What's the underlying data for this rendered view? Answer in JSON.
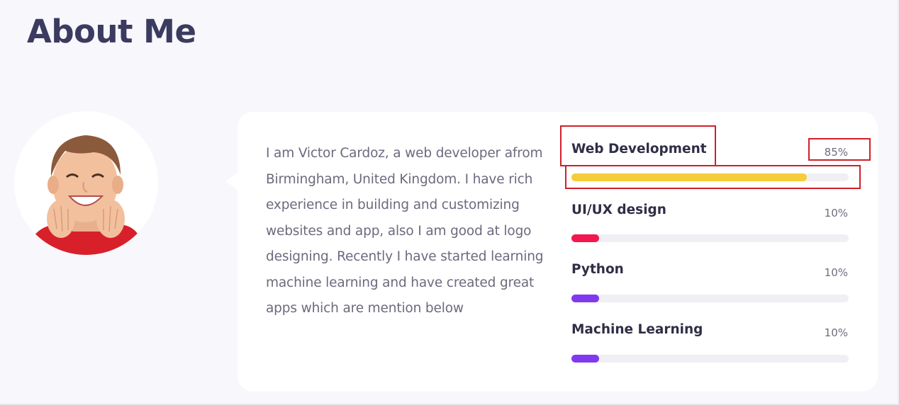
{
  "page": {
    "title": "About Me"
  },
  "profile": {
    "avatar_icon": "smiling-child-avatar",
    "bio": "I am Victor Cardoz, a web developer afrom Birmingham, United Kingdom. I have rich experience in building and customizing websites and app, also I am good at logo designing. Recently I have started learning machine learning and have created great apps which are mention below"
  },
  "skills": [
    {
      "name": "Web Development",
      "percent_label": "85%",
      "level": 0.85,
      "color": "#f5cc3b"
    },
    {
      "name": "UI/UX design",
      "percent_label": "10%",
      "level": 0.1,
      "color": "#f2174e"
    },
    {
      "name": "Python",
      "percent_label": "10%",
      "level": 0.1,
      "color": "#7f39f0"
    },
    {
      "name": "Machine Learning",
      "percent_label": "10%",
      "level": 0.1,
      "color": "#7f39f0"
    }
  ],
  "colors": {
    "page_background": "#f7f7fc",
    "title": "#3b3a5f",
    "highlight": "#d11f2a"
  }
}
